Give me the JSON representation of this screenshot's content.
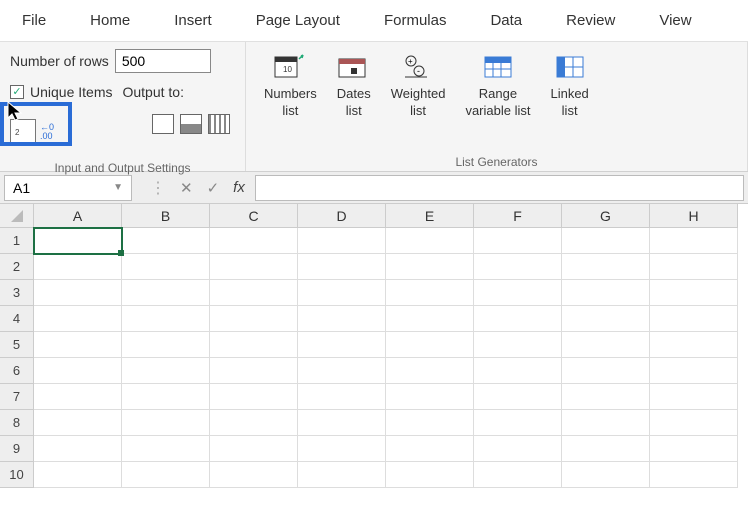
{
  "menubar": [
    "File",
    "Home",
    "Insert",
    "Page Layout",
    "Formulas",
    "Data",
    "Review",
    "View"
  ],
  "ribbon": {
    "io_group": {
      "rows_label": "Number of rows",
      "rows_value": "500",
      "unique_label": "Unique Items",
      "unique_checked": true,
      "output_label": "Output to:",
      "group_label": "Input and Output Settings"
    },
    "list_generators": {
      "group_label": "List Generators",
      "items": [
        {
          "line1": "Numbers",
          "line2": "list"
        },
        {
          "line1": "Dates",
          "line2": "list"
        },
        {
          "line1": "Weighted",
          "line2": "list"
        },
        {
          "line1": "Range",
          "line2": "variable list"
        },
        {
          "line1": "Linked",
          "line2": "list"
        }
      ]
    }
  },
  "namebox": "A1",
  "fx_label": "fx",
  "columns": [
    "A",
    "B",
    "C",
    "D",
    "E",
    "F",
    "G",
    "H"
  ],
  "rows": [
    "1",
    "2",
    "3",
    "4",
    "5",
    "6",
    "7",
    "8",
    "9",
    "10"
  ],
  "selected_cell": "A1"
}
